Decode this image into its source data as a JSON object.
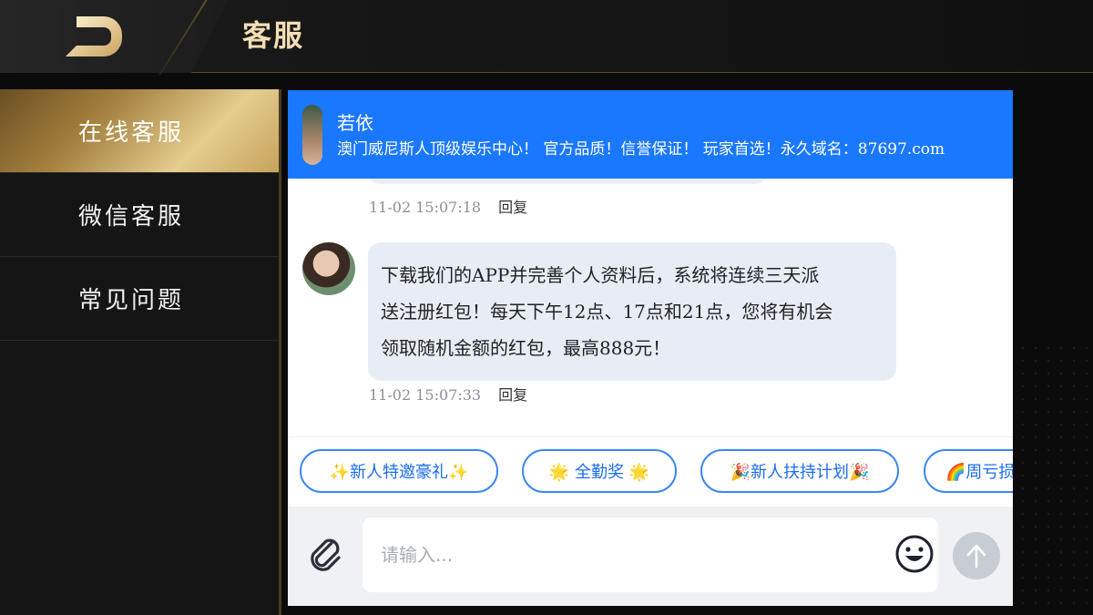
{
  "header": {
    "title": "客服"
  },
  "sidebar": {
    "items": [
      {
        "label": "在线客服",
        "active": true
      },
      {
        "label": "微信客服",
        "active": false
      },
      {
        "label": "常见问题",
        "active": false
      }
    ]
  },
  "chat": {
    "agent_name": "若依",
    "agent_slogan": "澳门威尼斯人顶级娱乐中心！ 官方品质！信誉保证！ 玩家首选！永久域名：87697.com",
    "messages": [
      {
        "time": "11-02 15:07:18",
        "reply": "回复"
      },
      {
        "lines": [
          "下载我们的APP并完善个人资料后，系统将连续三天派",
          "送注册红包！每天下午12点、17点和21点，您将有机会",
          "领取随机金额的红包，最高888元！"
        ],
        "time": "11-02 15:07:33",
        "reply": "回复"
      }
    ],
    "quick_chips": [
      "✨新人特邀豪礼✨",
      "🌟 全勤奖 🌟",
      "🎉新人扶持计划🎉",
      "🌈周亏损"
    ],
    "input": {
      "placeholder": "请输入..."
    }
  },
  "colors": {
    "header_bg": "#141414",
    "gold_text": "#f3dfb4",
    "chat_header_blue": "#1a78ff",
    "chip_blue": "#3a86f5",
    "bubble_bg": "#e8edf5"
  },
  "icons": {
    "back": "back-arrow-icon",
    "attach": "paperclip-icon",
    "emoji": "smiley-icon",
    "send": "arrow-up-icon"
  }
}
